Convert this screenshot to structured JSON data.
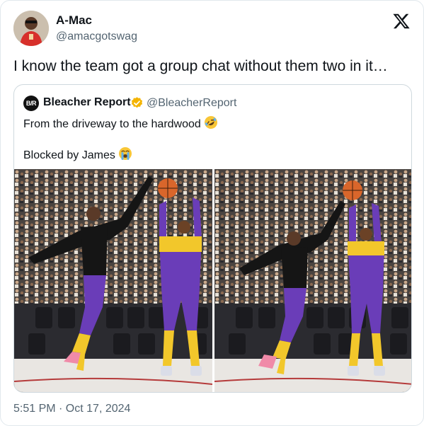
{
  "author": {
    "name": "A-Mac",
    "handle": "@amacgotswag",
    "avatar_icon": "user-avatar-icon"
  },
  "platform_icon": "x-logo-icon",
  "tweet": {
    "text": "I know the team got a group chat without them two in it…",
    "timestamp": "5:51 PM · Oct 17, 2024"
  },
  "quoted": {
    "logo_text": "B/R",
    "name": "Bleacher Report",
    "handle": "@BleacherReport",
    "verified_icon": "verified-badge-icon",
    "verified_color": "#f4b400",
    "line1": "From the driveway to the hardwood",
    "line1_emoji": "rolling-on-floor-laughing-emoji",
    "line2": "Blocked by James",
    "line2_emoji": "loudly-crying-face-emoji",
    "images": [
      {
        "description_icon": "basketball-photo-original"
      },
      {
        "description_icon": "basketball-photo-edited"
      }
    ]
  },
  "colors": {
    "text_primary": "#0f1419",
    "text_secondary": "#536471",
    "border": "#cfd9de",
    "lakers_purple": "#6a3db8",
    "lakers_gold": "#f2c72b"
  }
}
